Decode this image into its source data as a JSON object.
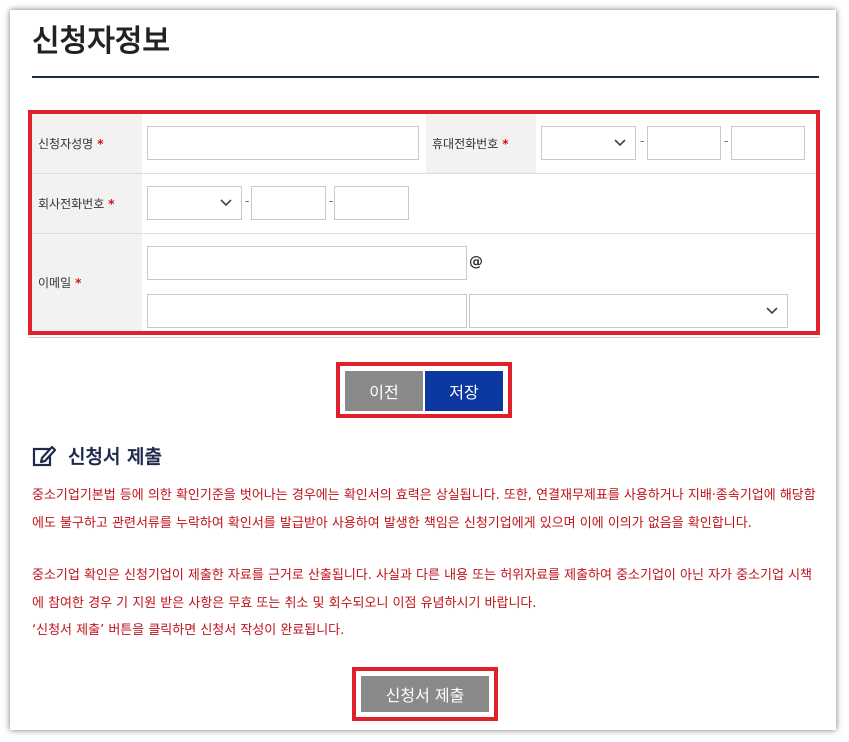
{
  "page": {
    "title": "신청자정보"
  },
  "form": {
    "applicant_name": {
      "label": "신청자성명",
      "required_mark": "*",
      "value": ""
    },
    "mobile": {
      "label": "휴대전화번호",
      "required_mark": "*",
      "prefix_value": "",
      "mid_value": "",
      "last_value": "",
      "separator": "-"
    },
    "company_phone": {
      "label": "회사전화번호",
      "required_mark": "*",
      "prefix_value": "",
      "mid_value": "",
      "last_value": "",
      "separator": "-"
    },
    "email": {
      "label": "이메일",
      "required_mark": "*",
      "id_value": "",
      "domain_value": "",
      "at_sign": "@",
      "domain_select_value": ""
    }
  },
  "buttons": {
    "prev_label": "이전",
    "save_label": "저장"
  },
  "submission": {
    "heading": "신청서 제출",
    "notice_1": "중소기업기본법 등에 의한 확인기준을 벗어나는 경우에는 확인서의 효력은 상실됩니다. 또한, 연결재무제표를 사용하거나 지배·종속기업에 해당함에도 불구하고 관련서류를 누락하여 확인서를 발급받아 사용하여 발생한 책임은 신청기업에게 있으며 이에 이의가 없음을 확인합니다.",
    "notice_2": "중소기업 확인은 신청기업이 제출한 자료를 근거로 산출됩니다. 사실과 다른 내용 또는 허위자료를 제출하여 중소기업이 아닌 자가 중소기업 시책에 참여한 경우 기 지원 받은 사항은 무효 또는 취소 및 회수되오니 이점 유념하시기 바랍니다.",
    "notice_3": "‘신청서 제출’ 버튼을 클릭하면 신청서 작성이 완료됩니다.",
    "submit_label": "신청서 제출"
  },
  "colors": {
    "accent_red": "#e0202a",
    "save_blue": "#0b37a0",
    "notice_red": "#c0121b",
    "navy": "#1f2a4d"
  },
  "icons": {
    "dropdown": "chevron-down-icon",
    "section": "edit-icon"
  }
}
